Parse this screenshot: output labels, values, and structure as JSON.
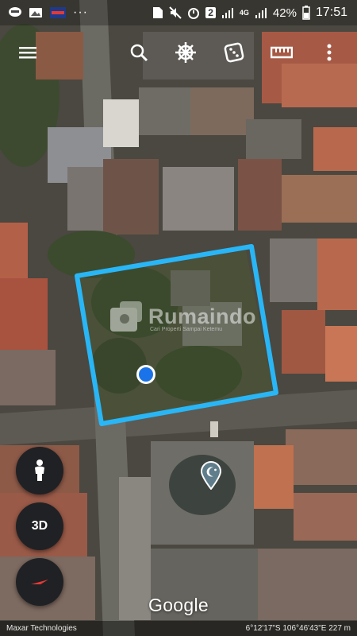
{
  "status_bar": {
    "notifications": [
      "line-icon",
      "gallery-icon",
      "hotstuff-app-icon",
      "more-dots-icon"
    ],
    "sim_badge": "2",
    "network_label": "4G",
    "battery_percent": "42%",
    "time": "17:51"
  },
  "toolbar": {
    "buttons": [
      "menu-icon",
      "search-icon",
      "voyager-wheel-icon",
      "dice-icon",
      "ruler-icon",
      "more-options-icon"
    ]
  },
  "controls": {
    "pegman": "pegman-icon",
    "three_d_label": "3D",
    "compass": "compass-icon"
  },
  "map": {
    "watermark_brand": "Rumaindo",
    "watermark_tagline": "Cari Properti Sampai Ketemu",
    "outline_color": "#29b6f6",
    "location_dot_color": "#1a73e8",
    "place_marker": "mosque-pin-icon"
  },
  "google_logo": "Google",
  "footer": {
    "attribution": "Maxar Technologies",
    "coordinates": "6°12'17\"S 106°46'43\"E 227 m"
  }
}
